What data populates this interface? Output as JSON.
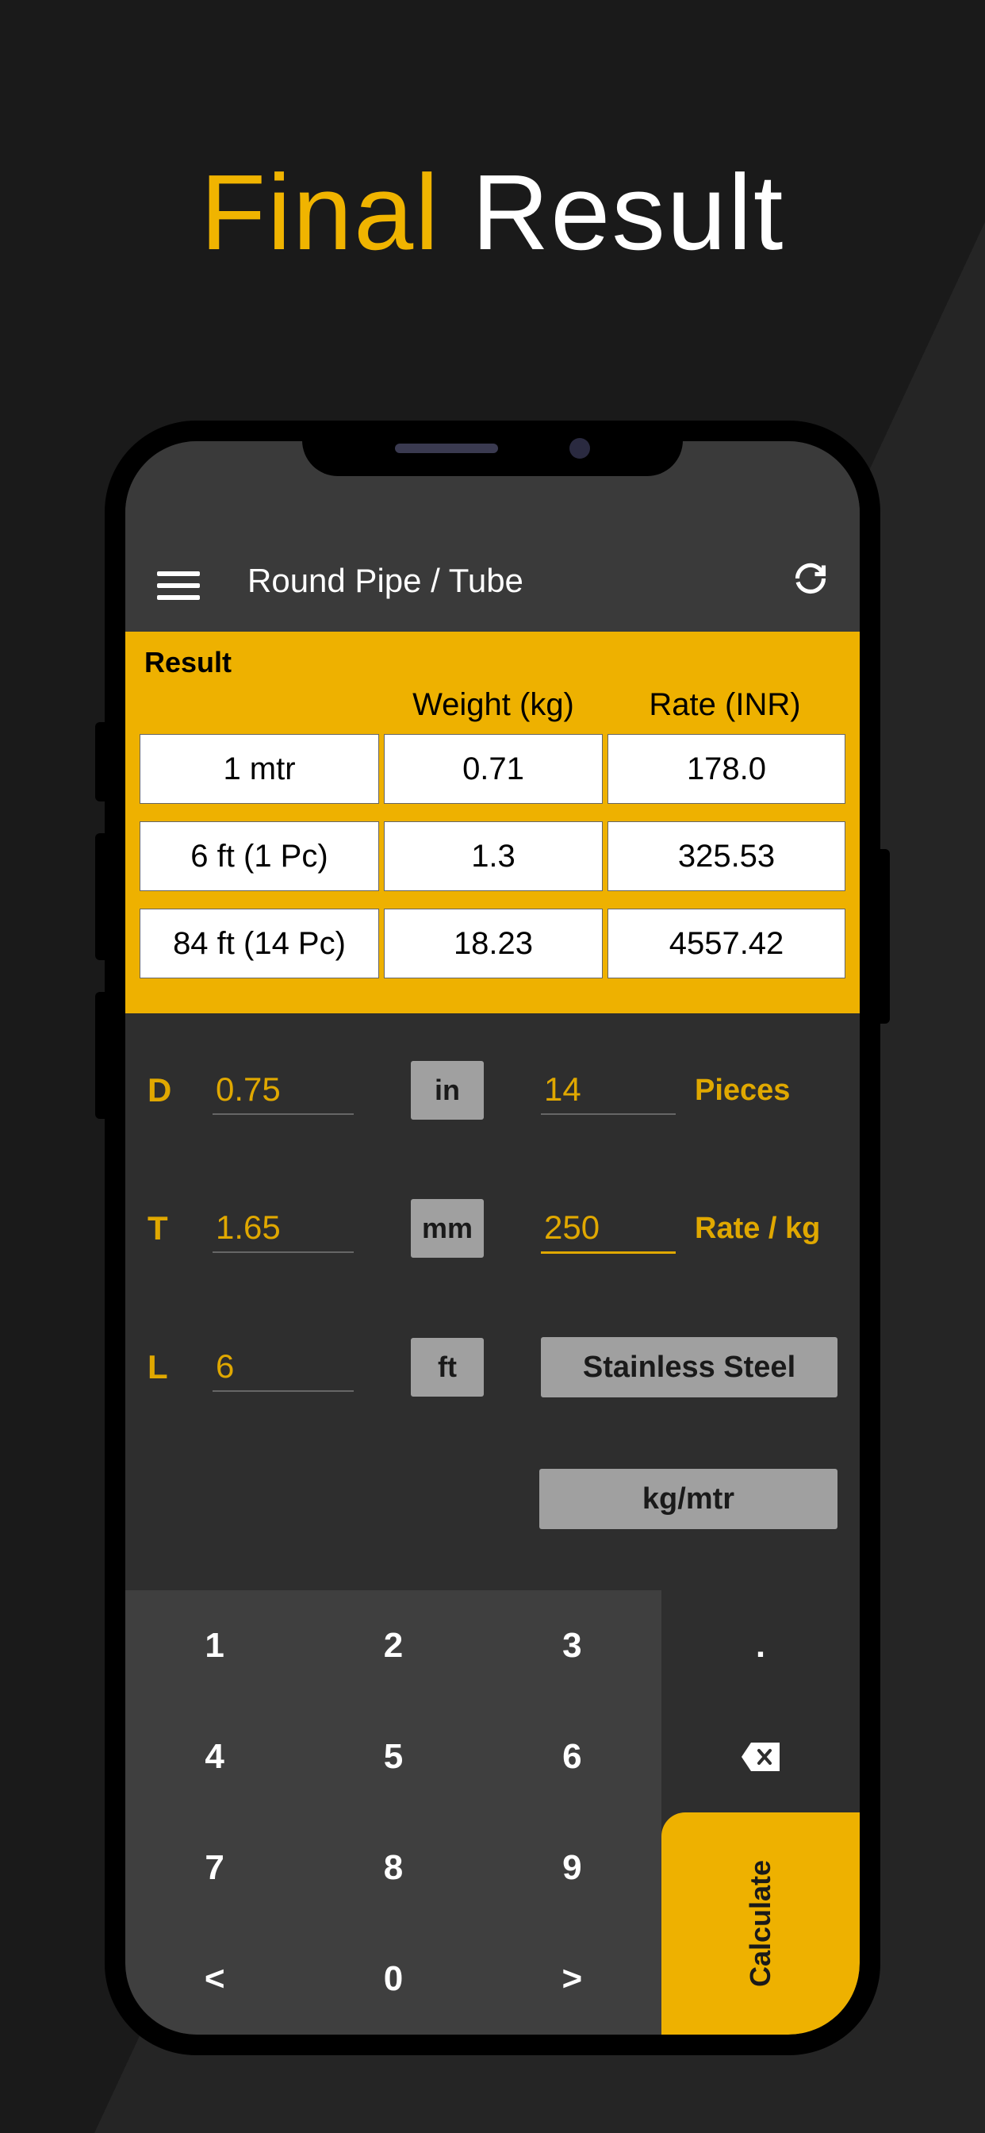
{
  "promo": {
    "word1": "Final",
    "word2": "Result"
  },
  "appbar": {
    "title": "Round Pipe / Tube"
  },
  "result": {
    "label": "Result",
    "headers": {
      "weight": "Weight (kg)",
      "rate": "Rate (INR)"
    },
    "rows": [
      {
        "label": "1 mtr",
        "weight": "0.71",
        "rate": "178.0"
      },
      {
        "label": "6 ft (1 Pc)",
        "weight": "1.3",
        "rate": "325.53"
      },
      {
        "label": "84 ft (14 Pc)",
        "weight": "18.23",
        "rate": "4557.42"
      }
    ]
  },
  "inputs": {
    "d": {
      "label": "D",
      "value": "0.75",
      "unit": "in"
    },
    "t": {
      "label": "T",
      "value": "1.65",
      "unit": "mm"
    },
    "l": {
      "label": "L",
      "value": "6",
      "unit": "ft"
    },
    "pieces": {
      "value": "14",
      "label": "Pieces"
    },
    "rate": {
      "value": "250",
      "label": "Rate / kg"
    },
    "material": "Stainless Steel",
    "output_unit": "kg/mtr"
  },
  "keypad": {
    "keys": [
      "1",
      "2",
      "3",
      "4",
      "5",
      "6",
      "7",
      "8",
      "9",
      "<",
      "0",
      ">"
    ],
    "dot": ".",
    "calculate": "Calculate"
  }
}
